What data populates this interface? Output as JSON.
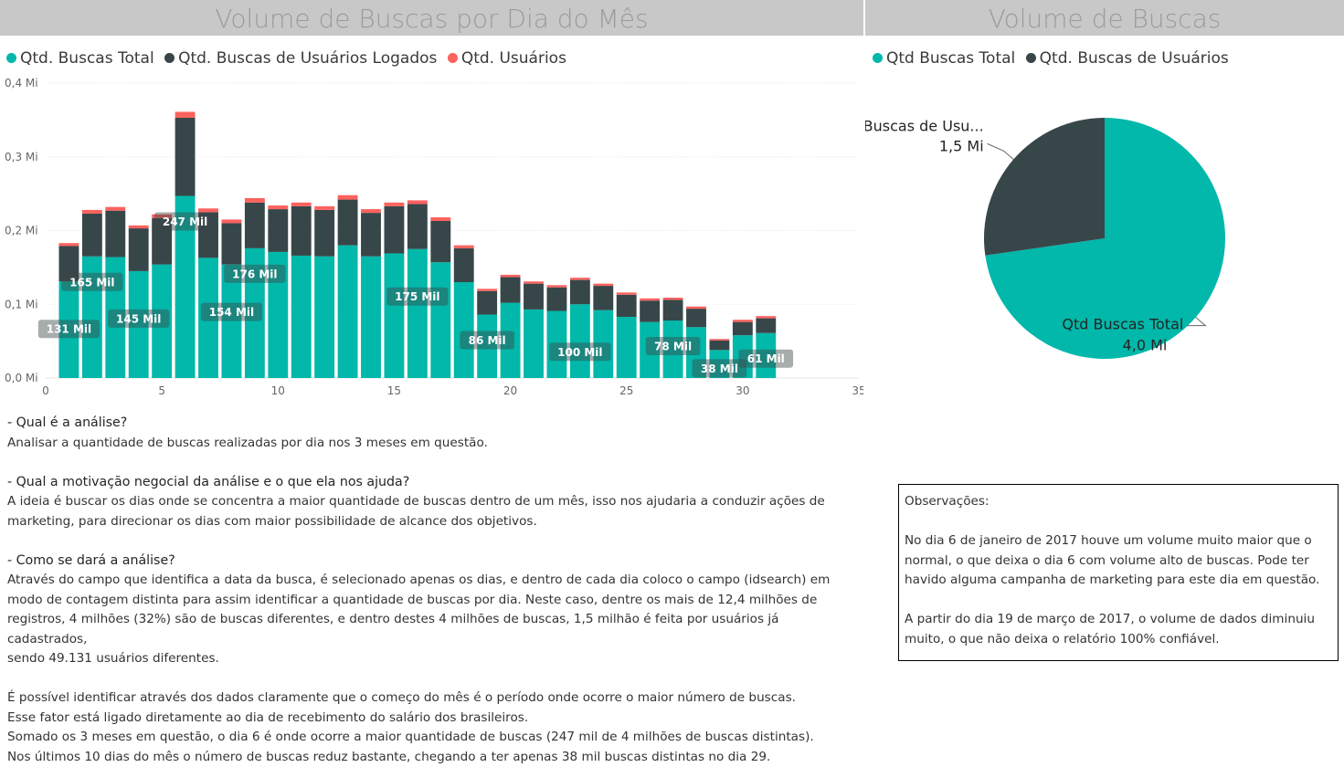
{
  "left_panel": {
    "title": "Volume de Buscas por Dia do Mês",
    "legend": [
      {
        "label": "Qtd. Buscas Total",
        "color": "#01b8aa"
      },
      {
        "label": "Qtd. Buscas de Usuários Logados",
        "color": "#374649"
      },
      {
        "label": "Qtd. Usuários",
        "color": "#fd625e"
      }
    ]
  },
  "right_panel": {
    "title": "Volume de Buscas",
    "legend": [
      {
        "label": "Qtd Buscas Total",
        "color": "#01b8aa"
      },
      {
        "label": "Qtd. Buscas de Usuários",
        "color": "#374649"
      }
    ]
  },
  "chart_data": [
    {
      "type": "bar",
      "stacked": true,
      "x": [
        1,
        2,
        3,
        4,
        5,
        6,
        7,
        8,
        9,
        10,
        11,
        12,
        13,
        14,
        15,
        16,
        17,
        18,
        19,
        20,
        21,
        22,
        23,
        24,
        25,
        26,
        27,
        28,
        29,
        30,
        31
      ],
      "xlim": [
        0,
        35
      ],
      "x_ticks": [
        "0",
        "5",
        "10",
        "15",
        "20",
        "25",
        "30",
        "35"
      ],
      "ylim": [
        0,
        0.4
      ],
      "y_ticks": [
        "0,0 Mi",
        "0,1 Mi",
        "0,2 Mi",
        "0,3 Mi",
        "0,4 Mi"
      ],
      "grid": true,
      "legend_position": "top-left",
      "series": [
        {
          "name": "Qtd. Buscas Total",
          "color": "#01b8aa",
          "values": [
            0.131,
            0.165,
            0.164,
            0.145,
            0.154,
            0.247,
            0.163,
            0.154,
            0.176,
            0.171,
            0.166,
            0.165,
            0.18,
            0.165,
            0.169,
            0.175,
            0.157,
            0.13,
            0.086,
            0.102,
            0.093,
            0.091,
            0.1,
            0.092,
            0.083,
            0.076,
            0.078,
            0.069,
            0.038,
            0.058,
            0.061
          ]
        },
        {
          "name": "Qtd. Buscas de Usuários Logados",
          "color": "#374649",
          "values": [
            0.048,
            0.058,
            0.063,
            0.058,
            0.063,
            0.106,
            0.062,
            0.056,
            0.062,
            0.058,
            0.067,
            0.063,
            0.062,
            0.059,
            0.064,
            0.061,
            0.056,
            0.046,
            0.032,
            0.035,
            0.035,
            0.032,
            0.033,
            0.033,
            0.03,
            0.029,
            0.028,
            0.025,
            0.013,
            0.018,
            0.02
          ]
        },
        {
          "name": "Qtd. Usuários",
          "color": "#fd625e",
          "values": [
            0.004,
            0.005,
            0.005,
            0.004,
            0.005,
            0.008,
            0.005,
            0.005,
            0.006,
            0.005,
            0.005,
            0.005,
            0.006,
            0.005,
            0.005,
            0.005,
            0.005,
            0.004,
            0.003,
            0.003,
            0.003,
            0.003,
            0.003,
            0.003,
            0.003,
            0.003,
            0.003,
            0.003,
            0.002,
            0.003,
            0.003
          ]
        }
      ],
      "data_labels": [
        {
          "x": 1,
          "text": "131 Mil"
        },
        {
          "x": 2,
          "text": "165 Mil"
        },
        {
          "x": 4,
          "text": "145 Mil"
        },
        {
          "x": 6,
          "text": "247 Mil"
        },
        {
          "x": 8,
          "text": "154 Mil"
        },
        {
          "x": 9,
          "text": "176 Mil"
        },
        {
          "x": 16,
          "text": "175 Mil"
        },
        {
          "x": 19,
          "text": "86 Mil"
        },
        {
          "x": 23,
          "text": "100 Mil"
        },
        {
          "x": 27,
          "text": "78 Mil"
        },
        {
          "x": 29,
          "text": "38 Mil"
        },
        {
          "x": 31,
          "text": "61 Mil"
        }
      ]
    },
    {
      "type": "pie",
      "slices": [
        {
          "label": "Qtd Buscas Total",
          "value": 4.0,
          "value_label": "4,0 Mi",
          "color": "#01b8aa"
        },
        {
          "label": "Qtd. Buscas de Usu...",
          "value": 1.5,
          "value_label": "1,5 Mi",
          "color": "#374649"
        }
      ]
    }
  ],
  "analysis": {
    "q1": "- Qual é a análise?",
    "a1": "Analisar a quantidade de buscas realizadas por dia nos 3 meses em questão.",
    "q2": "- Qual a motivação negocial da análise e o que ela nos ajuda?",
    "a2_l1": "A ideia é buscar os dias onde se concentra a maior quantidade de buscas dentro de um mês, isso nos ajudaria a conduzir ações de",
    "a2_l2": "marketing, para direcionar os dias com maior possibilidade de alcance dos objetivos.",
    "q3": "- Como se dará a análise?",
    "a3_l1": "Através do campo que identifica a data da busca, é selecionado apenas os dias, e dentro de cada dia coloco o campo (idsearch) em",
    "a3_l2": "modo de contagem distinta para assim identificar a quantidade de buscas por dia. Neste caso, dentre os mais de 12,4 milhões de",
    "a3_l3": "registros, 4 milhões (32%) são de buscas diferentes, e dentro destes 4 milhões de buscas, 1,5 milhão é feita por usuários já cadastrados,",
    "a3_l4": "sendo 49.131 usuários diferentes.",
    "c_l1": "É possível identificar através dos dados claramente que o começo do mês é o período onde ocorre o maior número de buscas.",
    "c_l2": "Esse fator está ligado diretamente ao dia de recebimento do salário dos brasileiros.",
    "c_l3": "Somado os 3 meses em questão, o dia 6 é onde ocorre a maior quantidade de buscas (247 mil de 4 milhões de buscas distintas).",
    "c_l4": "Nos últimos 10 dias do mês o número de buscas reduz bastante, chegando a ter apenas 38 mil buscas distintas no dia 29."
  },
  "observations": {
    "heading": "Observações:",
    "p1_l1": "No dia 6 de janeiro de 2017 houve um volume muito maior que o",
    "p1_l2": "normal, o que deixa o dia 6 com volume alto de buscas. Pode ter",
    "p1_l3": "havido alguma campanha de marketing para este dia em questão.",
    "p2_l1": "A partir do dia 19 de março de 2017, o volume de dados diminuiu",
    "p2_l2": "muito, o que não deixa o relatório 100% confiável."
  }
}
